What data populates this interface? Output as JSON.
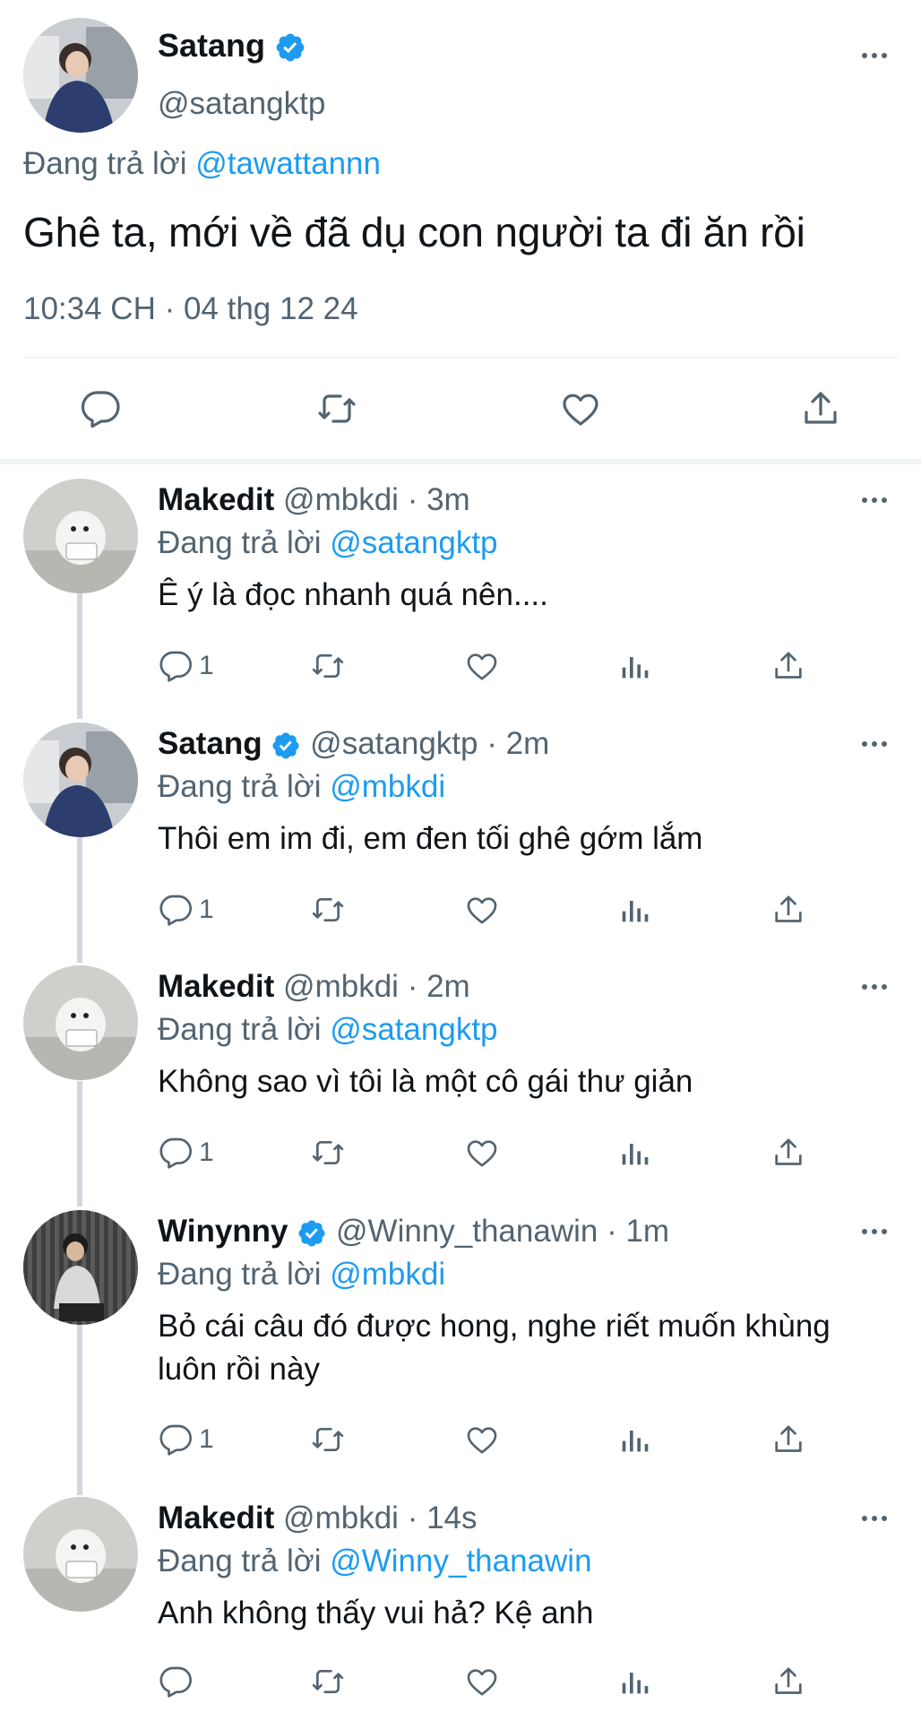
{
  "main_tweet": {
    "name": "Satang",
    "handle": "@satangktp",
    "reply_prefix": "Đang trả lời",
    "reply_to": "@tawattannn",
    "text": "Ghê ta, mới về đã dụ con người ta đi ăn rồi",
    "timestamp": "10:34 CH · 04 thg 12 24",
    "actions": [
      "reply-icon",
      "retweet-icon",
      "like-icon",
      "share-icon"
    ]
  },
  "replies": [
    {
      "name": "Makedit",
      "handle": "@mbkdi",
      "time": "· 3m",
      "verified": false,
      "reply_prefix": "Đang trả lời",
      "reply_to": "@satangktp",
      "text": "Ê ý là đọc nhanh quá nên....",
      "reply_count": "1"
    },
    {
      "name": "Satang",
      "handle": "@satangktp",
      "time": "· 2m",
      "verified": true,
      "reply_prefix": "Đang trả lời",
      "reply_to": "@mbkdi",
      "text": "Thôi em im đi, em đen tối ghê gớm lắm",
      "reply_count": "1"
    },
    {
      "name": "Makedit",
      "handle": "@mbkdi",
      "time": "· 2m",
      "verified": false,
      "reply_prefix": "Đang trả lời",
      "reply_to": "@satangktp",
      "text": "Không sao vì tôi là một cô gái thư giản",
      "reply_count": "1"
    },
    {
      "name": "Winynny",
      "handle": "@Winny_thanawin",
      "time": "· 1m",
      "verified": true,
      "reply_prefix": "Đang trả lời",
      "reply_to": "@mbkdi",
      "text": "Bỏ cái câu đó được hong, nghe riết muốn khùng luôn rồi này",
      "reply_count": "1"
    },
    {
      "name": "Makedit",
      "handle": "@mbkdi",
      "time": "· 14s",
      "verified": false,
      "reply_prefix": "Đang trả lời",
      "reply_to": "@Winny_thanawin",
      "text": "Anh không thấy vui hả? Kệ anh",
      "reply_count": ""
    }
  ],
  "colors": {
    "accent": "#1d9bf0",
    "secondary_text": "#536471",
    "divider": "#eff3f4"
  }
}
